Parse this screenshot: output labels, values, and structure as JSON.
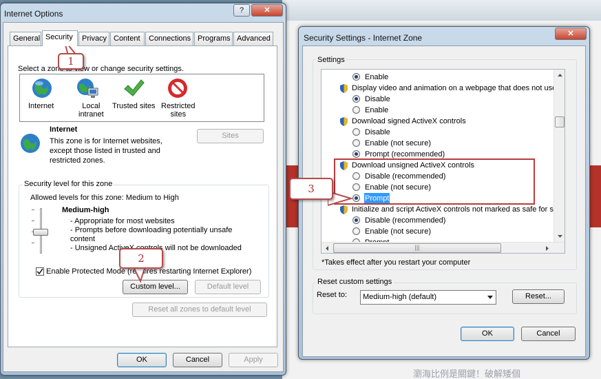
{
  "background": {
    "bottom_text": "瀏海比例是關鍵！破解矮個"
  },
  "internet_options": {
    "title": "Internet Options",
    "help_btn": "?",
    "close_btn": "✕",
    "tabs": [
      "General",
      "Security",
      "Privacy",
      "Content",
      "Connections",
      "Programs",
      "Advanced"
    ],
    "select_zone_text": "Select a zone to view or change security settings.",
    "zones": [
      {
        "label": "Internet"
      },
      {
        "label": "Local\nintranet"
      },
      {
        "label": "Trusted sites"
      },
      {
        "label": "Restricted\nsites"
      }
    ],
    "zone_title": "Internet",
    "zone_desc_1": "This zone is for Internet websites,",
    "zone_desc_2": "except those listed in trusted and",
    "zone_desc_3": "restricted zones.",
    "sites_btn": "Sites",
    "security_level_label": "Security level for this zone",
    "allowed_levels": "Allowed levels for this zone: Medium to High",
    "level_name": "Medium-high",
    "level_desc_1": "- Appropriate for most websites",
    "level_desc_2": "- Prompts before downloading potentially unsafe",
    "level_desc_3": "content",
    "level_desc_4": "- Unsigned ActiveX controls will not be downloaded",
    "protected_mode": "Enable Protected Mode (requires restarting Internet Explorer)",
    "custom_level_btn": "Custom level...",
    "default_level_btn": "Default level",
    "reset_all_btn": "Reset all zones to default level",
    "ok_btn": "OK",
    "cancel_btn": "Cancel",
    "apply_btn": "Apply"
  },
  "security_settings": {
    "title": "Security Settings - Internet Zone",
    "close_btn": "✕",
    "settings_label": "Settings",
    "items": [
      {
        "type": "radio",
        "text": "Enable",
        "checked": true
      },
      {
        "type": "header",
        "text": "Display video and animation on a webpage that does not use"
      },
      {
        "type": "radio",
        "text": "Disable",
        "checked": true
      },
      {
        "type": "radio",
        "text": "Enable",
        "checked": false
      },
      {
        "type": "header",
        "text": "Download signed ActiveX controls"
      },
      {
        "type": "radio",
        "text": "Disable",
        "checked": false
      },
      {
        "type": "radio",
        "text": "Enable (not secure)",
        "checked": false
      },
      {
        "type": "radio",
        "text": "Prompt (recommended)",
        "checked": true
      },
      {
        "type": "header",
        "text": "Download unsigned ActiveX controls"
      },
      {
        "type": "radio",
        "text": "Disable (recommended)",
        "checked": false
      },
      {
        "type": "radio",
        "text": "Enable (not secure)",
        "checked": false
      },
      {
        "type": "radio",
        "text": "Prompt",
        "checked": true,
        "selected": true
      },
      {
        "type": "header",
        "text": "Initialize and script ActiveX controls not marked as safe for s"
      },
      {
        "type": "radio",
        "text": "Disable (recommended)",
        "checked": true
      },
      {
        "type": "radio",
        "text": "Enable (not secure)",
        "checked": false
      },
      {
        "type": "radio",
        "text": "Prompt",
        "checked": false
      }
    ],
    "restart_note": "*Takes effect after you restart your computer",
    "reset_custom_label": "Reset custom settings",
    "reset_to_label": "Reset to:",
    "reset_to_value": "Medium-high (default)",
    "reset_btn": "Reset...",
    "ok_btn": "OK",
    "cancel_btn": "Cancel"
  },
  "callouts": [
    "1",
    "2",
    "3"
  ],
  "colors": {
    "callout": "#b54a4a",
    "selection": "#3399ff"
  }
}
